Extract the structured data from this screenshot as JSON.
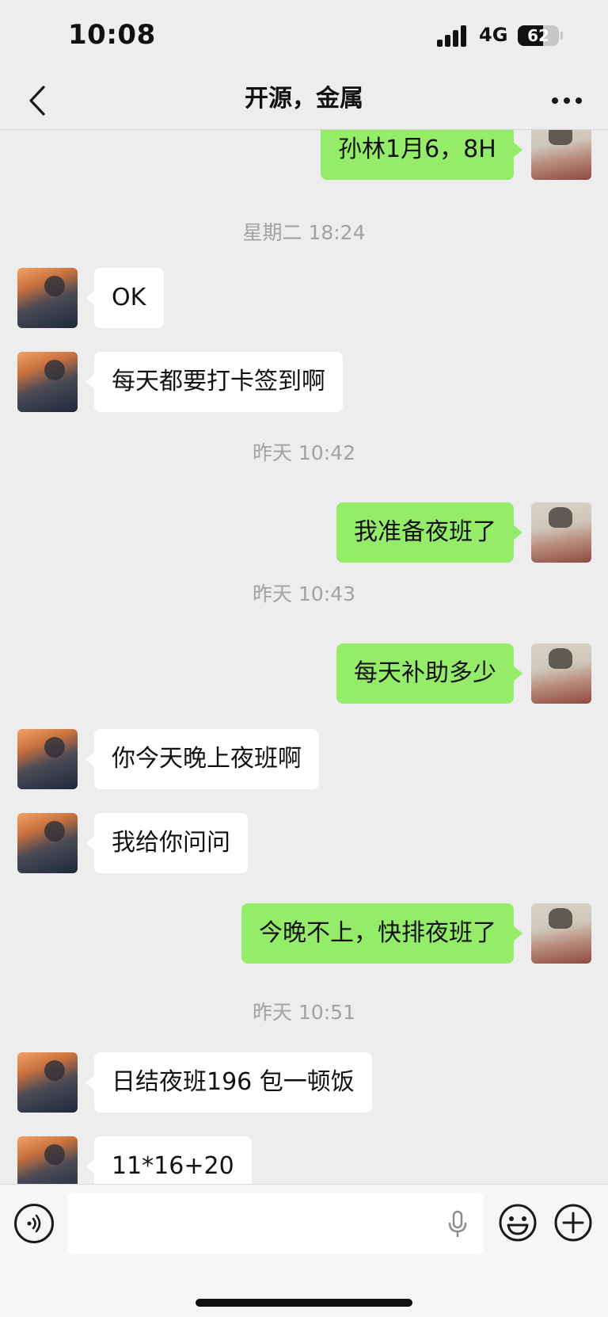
{
  "status_bar": {
    "time": "10:08",
    "network": "4G",
    "battery_percent": 62,
    "battery_text": "62"
  },
  "nav": {
    "title": "开源，金属",
    "back_icon": "chevron-left-icon",
    "more_icon": "ellipsis-icon"
  },
  "messages": [
    {
      "type": "message",
      "sender": "me",
      "text": "孙林1月6，8H"
    },
    {
      "type": "timestamp",
      "text": "星期二 18:24"
    },
    {
      "type": "message",
      "sender": "other",
      "text": "OK"
    },
    {
      "type": "message",
      "sender": "other",
      "text": "每天都要打卡签到啊"
    },
    {
      "type": "timestamp",
      "text": "昨天 10:42"
    },
    {
      "type": "message",
      "sender": "me",
      "text": "我准备夜班了"
    },
    {
      "type": "timestamp",
      "text": "昨天 10:43"
    },
    {
      "type": "message",
      "sender": "me",
      "text": "每天补助多少"
    },
    {
      "type": "message",
      "sender": "other",
      "text": "你今天晚上夜班啊"
    },
    {
      "type": "message",
      "sender": "other",
      "text": "我给你问问"
    },
    {
      "type": "message",
      "sender": "me",
      "text": "今晚不上，快排夜班了"
    },
    {
      "type": "timestamp",
      "text": "昨天 10:51"
    },
    {
      "type": "message",
      "sender": "other",
      "text": "日结夜班196 包一顿饭"
    },
    {
      "type": "message",
      "sender": "other",
      "text": "11*16+20"
    }
  ],
  "input": {
    "value": "",
    "placeholder": ""
  },
  "colors": {
    "background": "#ededed",
    "bubble_me": "#95ec69",
    "bubble_other": "#ffffff",
    "timestamp": "#a2a2a2"
  }
}
